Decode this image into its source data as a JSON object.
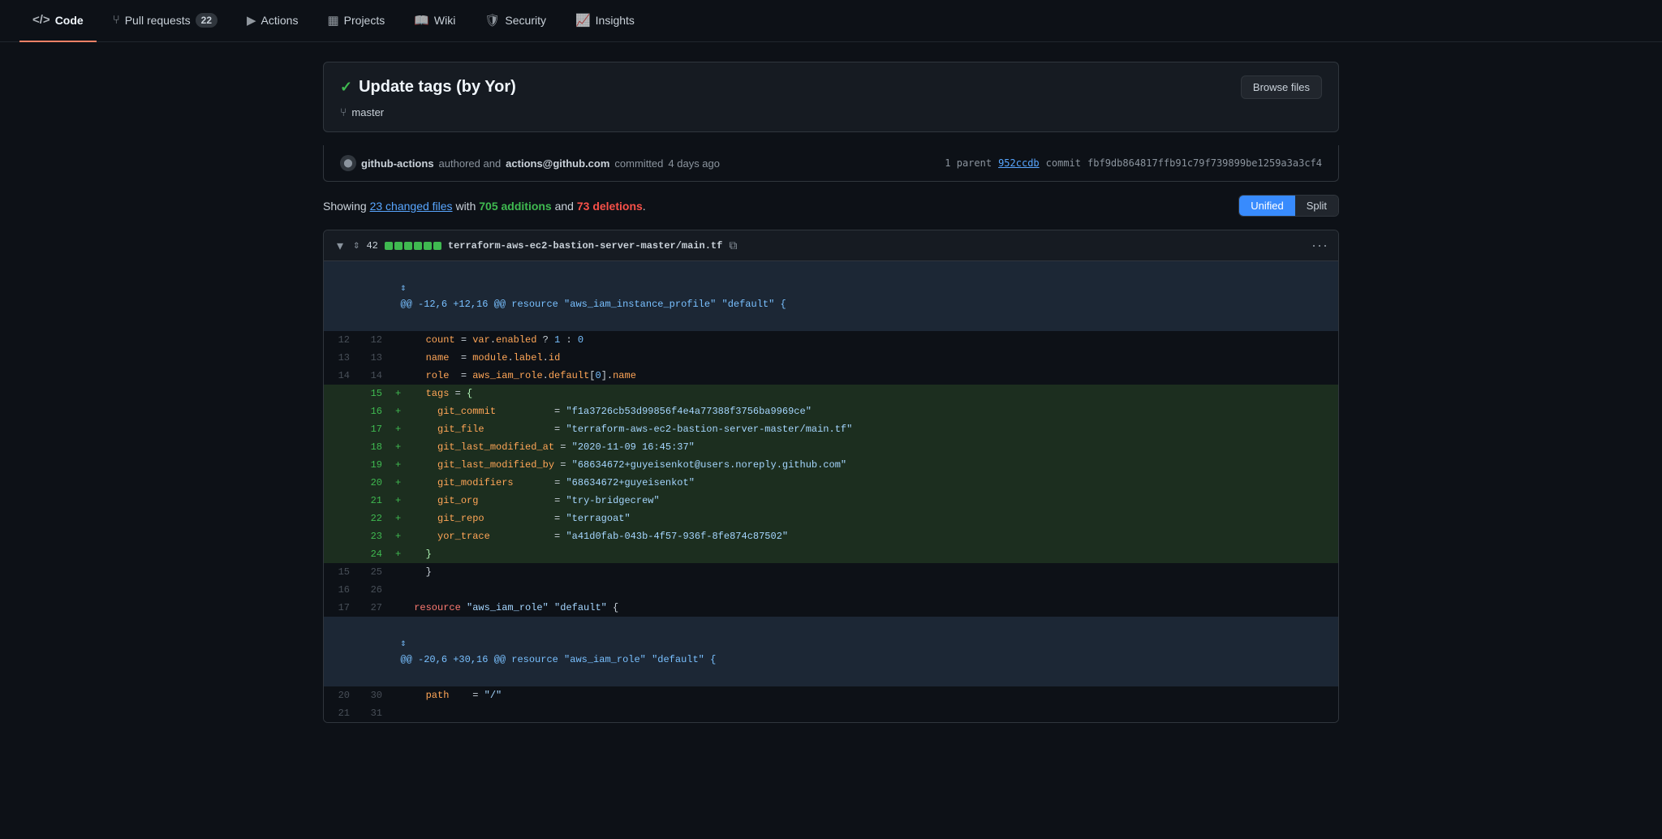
{
  "nav": {
    "items": [
      {
        "id": "code",
        "label": "Code",
        "icon": "</>",
        "active": true,
        "badge": null
      },
      {
        "id": "pull-requests",
        "label": "Pull requests",
        "icon": "⑂",
        "active": false,
        "badge": "22"
      },
      {
        "id": "actions",
        "label": "Actions",
        "icon": "▶",
        "active": false,
        "badge": null
      },
      {
        "id": "projects",
        "label": "Projects",
        "icon": "▦",
        "active": false,
        "badge": null
      },
      {
        "id": "wiki",
        "label": "Wiki",
        "icon": "📖",
        "active": false,
        "badge": null
      },
      {
        "id": "security",
        "label": "Security",
        "icon": "🛡",
        "active": false,
        "badge": null
      },
      {
        "id": "insights",
        "label": "Insights",
        "icon": "📈",
        "active": false,
        "badge": null
      }
    ]
  },
  "commit": {
    "status_icon": "✓",
    "title": "Update tags (by Yor)",
    "branch": "master",
    "author": "github-actions",
    "authored_text": "authored and",
    "committer": "actions@github.com",
    "committed_text": "committed",
    "time_ago": "4 days ago",
    "parent_label": "1 parent",
    "parent_hash": "952ccdb",
    "commit_label": "commit",
    "full_hash": "fbf9db864817ffb91c79f739899be1259a3a3cf4",
    "browse_files_label": "Browse files"
  },
  "diff_stats": {
    "showing_text": "Showing",
    "changed_files_count": "23 changed files",
    "with_text": "with",
    "additions": "705 additions",
    "and_text": "and",
    "deletions": "73 deletions",
    "period": ".",
    "view_unified": "Unified",
    "view_split": "Split"
  },
  "file_diff": {
    "stat_number": "42",
    "file_name": "terraform-aws-ec2-bastion-server-master/main.tf",
    "hunk1": "@@ -12,6 +12,16 @@ resource \"aws_iam_instance_profile\" \"default\" {",
    "hunk2": "@@ -20,6 +30,16 @@ resource \"aws_iam_role\" \"default\" {",
    "lines": [
      {
        "old": "12",
        "new": "12",
        "type": "normal",
        "sign": " ",
        "content": "  count = var.enabled ? 1 : 0"
      },
      {
        "old": "13",
        "new": "13",
        "type": "normal",
        "sign": " ",
        "content": "  name  = module.label.id"
      },
      {
        "old": "14",
        "new": "14",
        "type": "normal",
        "sign": " ",
        "content": "  role  = aws_iam_role.default[0].name"
      },
      {
        "old": "",
        "new": "15",
        "type": "add",
        "sign": "+",
        "content": "  tags = {"
      },
      {
        "old": "",
        "new": "16",
        "type": "add",
        "sign": "+",
        "content": "    git_commit          = \"f1a3726cb53d99856f4e4a77388f3756ba9969ce\""
      },
      {
        "old": "",
        "new": "17",
        "type": "add",
        "sign": "+",
        "content": "    git_file            = \"terraform-aws-ec2-bastion-server-master/main.tf\""
      },
      {
        "old": "",
        "new": "18",
        "type": "add",
        "sign": "+",
        "content": "    git_last_modified_at = \"2020-11-09 16:45:37\""
      },
      {
        "old": "",
        "new": "19",
        "type": "add",
        "sign": "+",
        "content": "    git_last_modified_by = \"68634672+guyeisenkot@users.noreply.github.com\""
      },
      {
        "old": "",
        "new": "20",
        "type": "add",
        "sign": "+",
        "content": "    git_modifiers       = \"68634672+guyeisenkot\""
      },
      {
        "old": "",
        "new": "21",
        "type": "add",
        "sign": "+",
        "content": "    git_org             = \"try-bridgecrew\""
      },
      {
        "old": "",
        "new": "22",
        "type": "add",
        "sign": "+",
        "content": "    git_repo            = \"terragoat\""
      },
      {
        "old": "",
        "new": "23",
        "type": "add",
        "sign": "+",
        "content": "    yor_trace           = \"a41d0fab-043b-4f57-936f-8fe874c87502\""
      },
      {
        "old": "",
        "new": "24",
        "type": "add",
        "sign": "+",
        "content": "  }"
      },
      {
        "old": "15",
        "new": "25",
        "type": "normal",
        "sign": " ",
        "content": "  }"
      },
      {
        "old": "16",
        "new": "26",
        "type": "normal",
        "sign": " ",
        "content": ""
      },
      {
        "old": "17",
        "new": "27",
        "type": "normal",
        "sign": " ",
        "content": "resource \"aws_iam_role\" \"default\" {"
      }
    ],
    "lines2": [
      {
        "old": "20",
        "new": "30",
        "type": "normal",
        "sign": " ",
        "content": "  path    = \"/\""
      },
      {
        "old": "21",
        "new": "31",
        "type": "normal",
        "sign": " ",
        "content": ""
      }
    ]
  }
}
